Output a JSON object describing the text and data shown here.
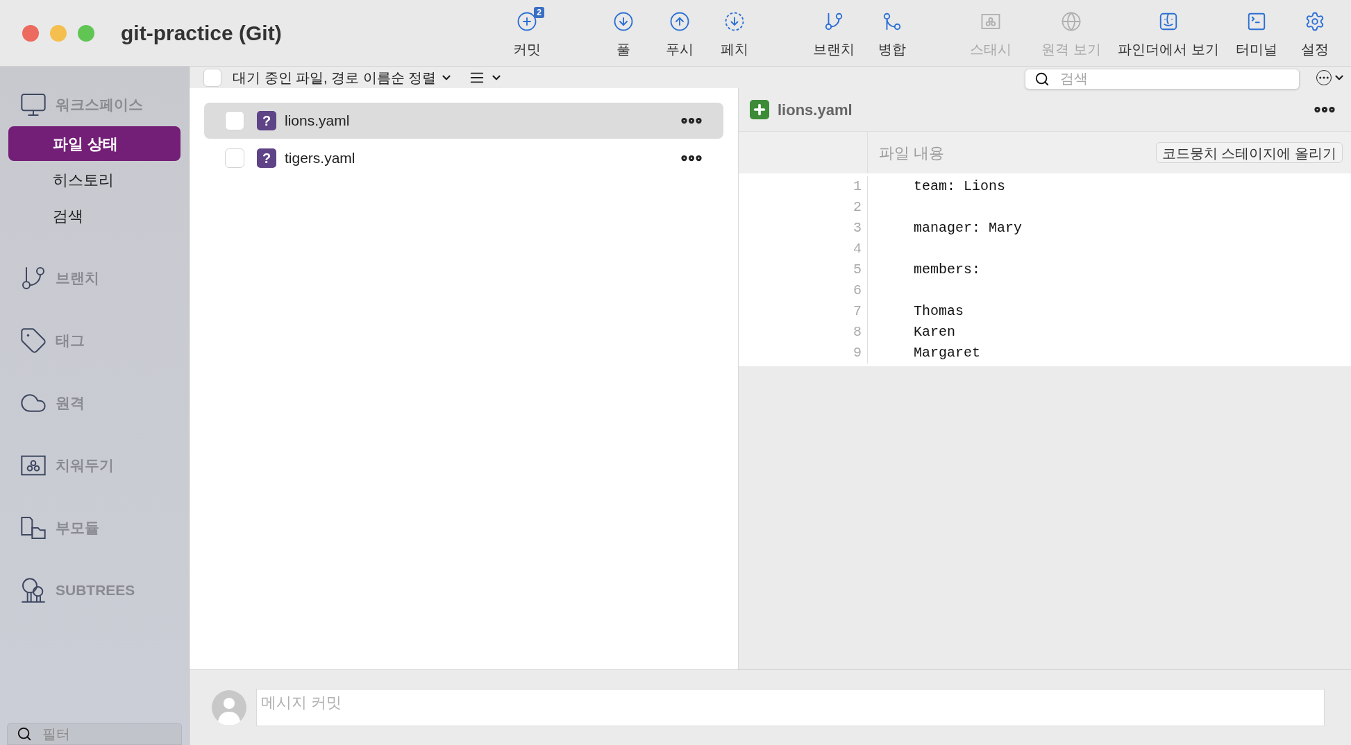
{
  "window": {
    "title": "git-practice (Git)"
  },
  "toolbar": [
    {
      "label": "커밋",
      "kind": "commit",
      "disabled": false,
      "badge": "2"
    },
    {
      "label": "풀",
      "kind": "pull",
      "disabled": false
    },
    {
      "label": "푸시",
      "kind": "push",
      "disabled": false
    },
    {
      "label": "페치",
      "kind": "fetch",
      "disabled": false
    },
    {
      "label": "브랜치",
      "kind": "branch",
      "disabled": false
    },
    {
      "label": "병합",
      "kind": "merge",
      "disabled": false
    },
    {
      "label": "스태시",
      "kind": "stash",
      "disabled": true
    },
    {
      "label": "원격 보기",
      "kind": "remote",
      "disabled": true
    },
    {
      "label": "파인더에서 보기",
      "kind": "finder",
      "disabled": false
    },
    {
      "label": "터미널",
      "kind": "terminal",
      "disabled": false
    },
    {
      "label": "설정",
      "kind": "settings",
      "disabled": false
    }
  ],
  "sidebar": {
    "sections": [
      {
        "label": "워크스페이스",
        "kind": "workspace",
        "children": [
          {
            "label": "파일 상태",
            "selected": true
          },
          {
            "label": "히스토리",
            "selected": false
          },
          {
            "label": "검색",
            "selected": false
          }
        ]
      },
      {
        "label": "브랜치",
        "kind": "branch"
      },
      {
        "label": "태그",
        "kind": "tag"
      },
      {
        "label": "원격",
        "kind": "remote"
      },
      {
        "label": "치워두기",
        "kind": "stash"
      },
      {
        "label": "부모듈",
        "kind": "submodule"
      },
      {
        "label": "SUBTREES",
        "kind": "subtree"
      }
    ],
    "filter": {
      "placeholder": "필터"
    }
  },
  "file_list": {
    "select_all_checked": false,
    "sort_label": "대기 중인 파일, 경로 이름순 정렬",
    "files": [
      {
        "name": "lions.yaml",
        "status_mark": "?",
        "checked": false,
        "selected": true
      },
      {
        "name": "tigers.yaml",
        "status_mark": "?",
        "checked": false,
        "selected": false
      }
    ]
  },
  "search": {
    "placeholder": "검색"
  },
  "diff": {
    "file": {
      "name": "lions.yaml",
      "kind": "added"
    },
    "hunk_title": "파일 내용",
    "stage_button": "코드뭉치 스테이지에 올리기",
    "lines": [
      {
        "number": "1",
        "text": "team: Lions"
      },
      {
        "number": "2"
      },
      {
        "number": "3",
        "text": "manager: Mary"
      },
      {
        "number": "4"
      },
      {
        "number": "5",
        "text": "members:"
      },
      {
        "number": "6"
      },
      {
        "number": "7",
        "text": "Thomas"
      },
      {
        "number": "8",
        "text": "Karen"
      },
      {
        "number": "9",
        "text": "Margaret"
      }
    ]
  },
  "commit": {
    "placeholder": "메시지 커밋"
  }
}
